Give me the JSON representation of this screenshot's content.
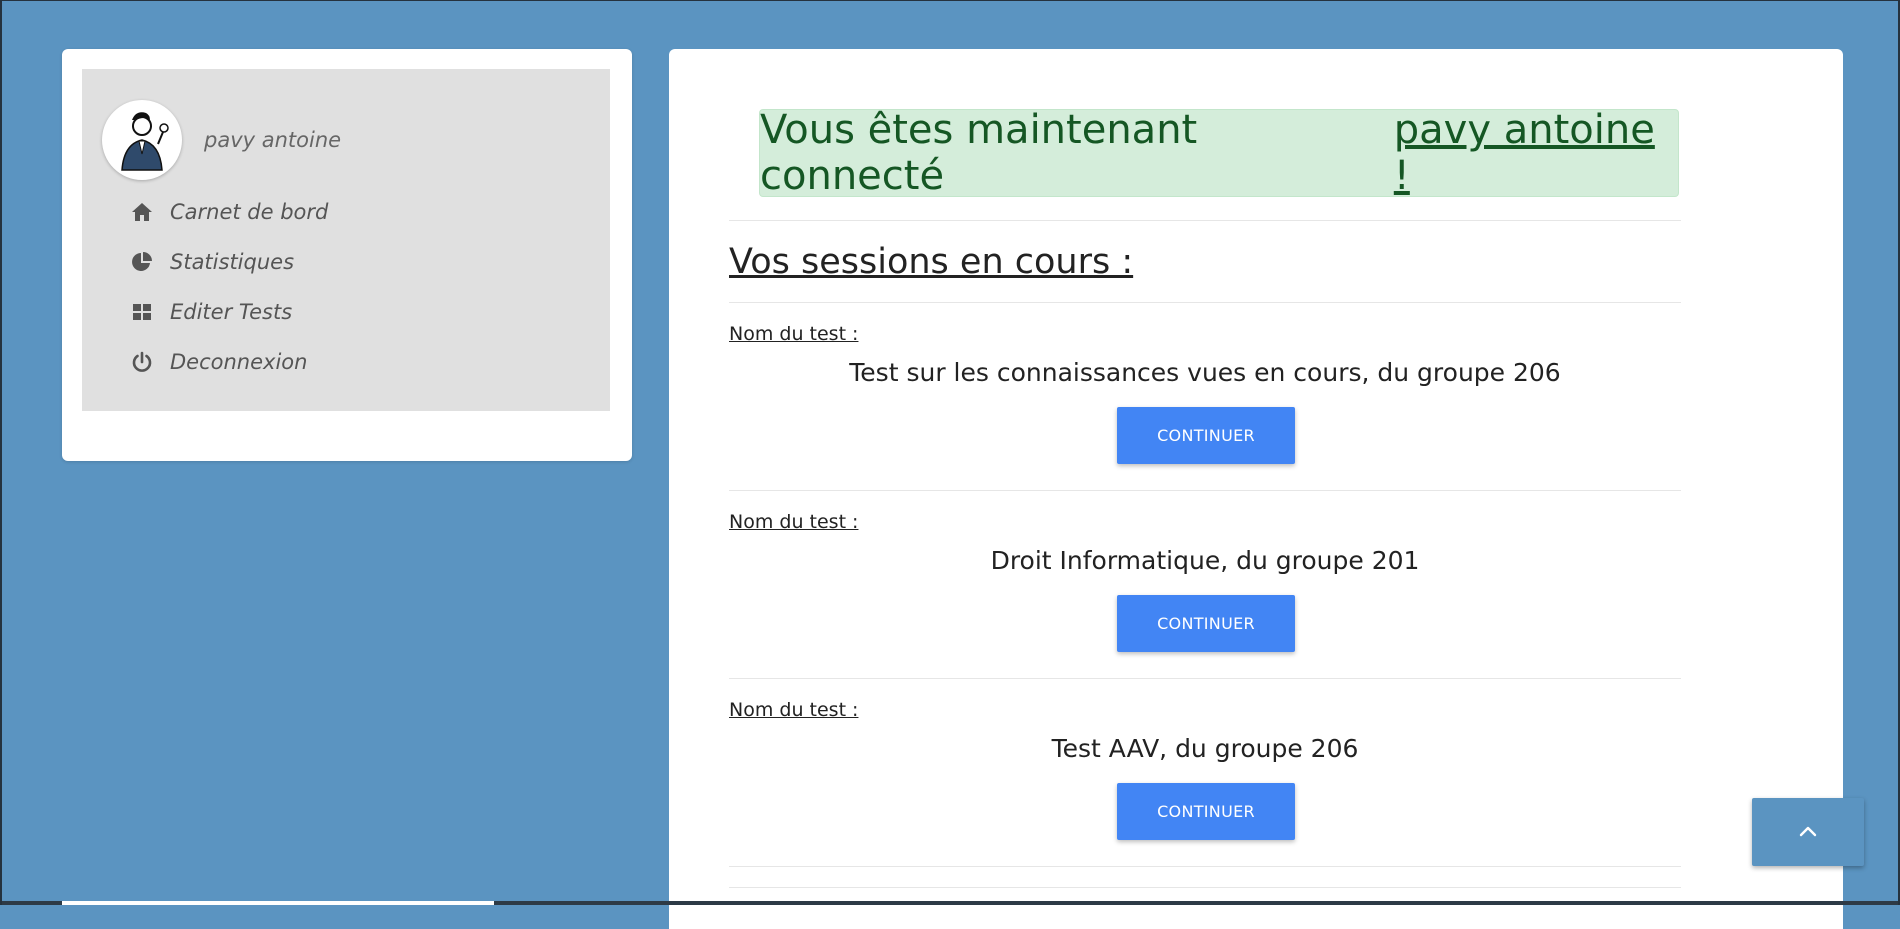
{
  "sidebar": {
    "user_name": "pavy antoine",
    "items": [
      {
        "label": "Carnet de bord",
        "icon": "home-icon"
      },
      {
        "label": "Statistiques",
        "icon": "pie-chart-icon"
      },
      {
        "label": "Editer Tests",
        "icon": "grid-icon"
      },
      {
        "label": "Deconnexion",
        "icon": "power-icon"
      }
    ]
  },
  "main": {
    "alert": {
      "prefix": "Vous êtes maintenant connecté",
      "user": "pavy antoine !"
    },
    "sessions_title": "Vos sessions en cours :",
    "sessions": [
      {
        "label": "Nom du test :",
        "name": "Test sur les connaissances vues en cours, du groupe 206",
        "button": "CONTINUER"
      },
      {
        "label": "Nom du test :",
        "name": "Droit Informatique, du groupe 201",
        "button": "CONTINUER"
      },
      {
        "label": "Nom du test :",
        "name": "Test AAV, du groupe 206",
        "button": "CONTINUER"
      }
    ]
  },
  "scroll_top": {
    "icon": "chevron-up-icon"
  },
  "colors": {
    "background": "#5b94c1",
    "button": "#4285f4",
    "alert_bg": "#d4edda",
    "alert_text": "#155724"
  }
}
